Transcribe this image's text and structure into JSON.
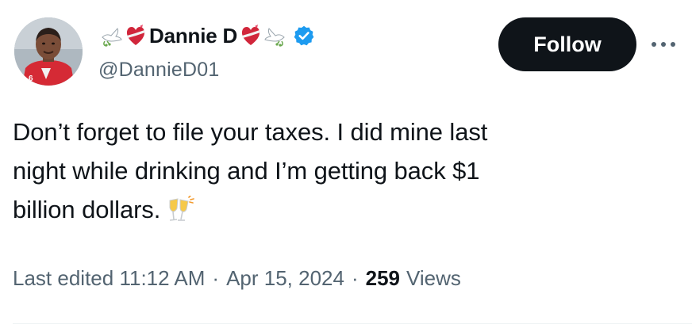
{
  "author": {
    "display_name": "Dannie D",
    "handle": "@DannieD01",
    "verified_color": "#1d9bf0",
    "name_emojis_left": [
      "dove-icon",
      "heart-with-ribbon-icon"
    ],
    "name_emojis_right": [
      "heart-with-ribbon-icon",
      "dove-icon"
    ]
  },
  "actions": {
    "follow_label": "Follow",
    "more_icon": "more-dots-icon"
  },
  "tweet": {
    "lines": [
      "Don’t forget to file your taxes. I did mine last",
      "night while drinking and I’m getting back $1",
      "billion dollars."
    ],
    "trailing_emoji": "clinking-glasses-icon"
  },
  "meta": {
    "edited_label": "Last edited",
    "time": "11:12 AM",
    "separator": "·",
    "date": "Apr 15, 2024",
    "views_count": "259",
    "views_label": "Views"
  },
  "colors": {
    "text_primary": "#0f1419",
    "text_secondary": "#536471",
    "button_bg": "#0f1419",
    "verified": "#1d9bf0"
  }
}
